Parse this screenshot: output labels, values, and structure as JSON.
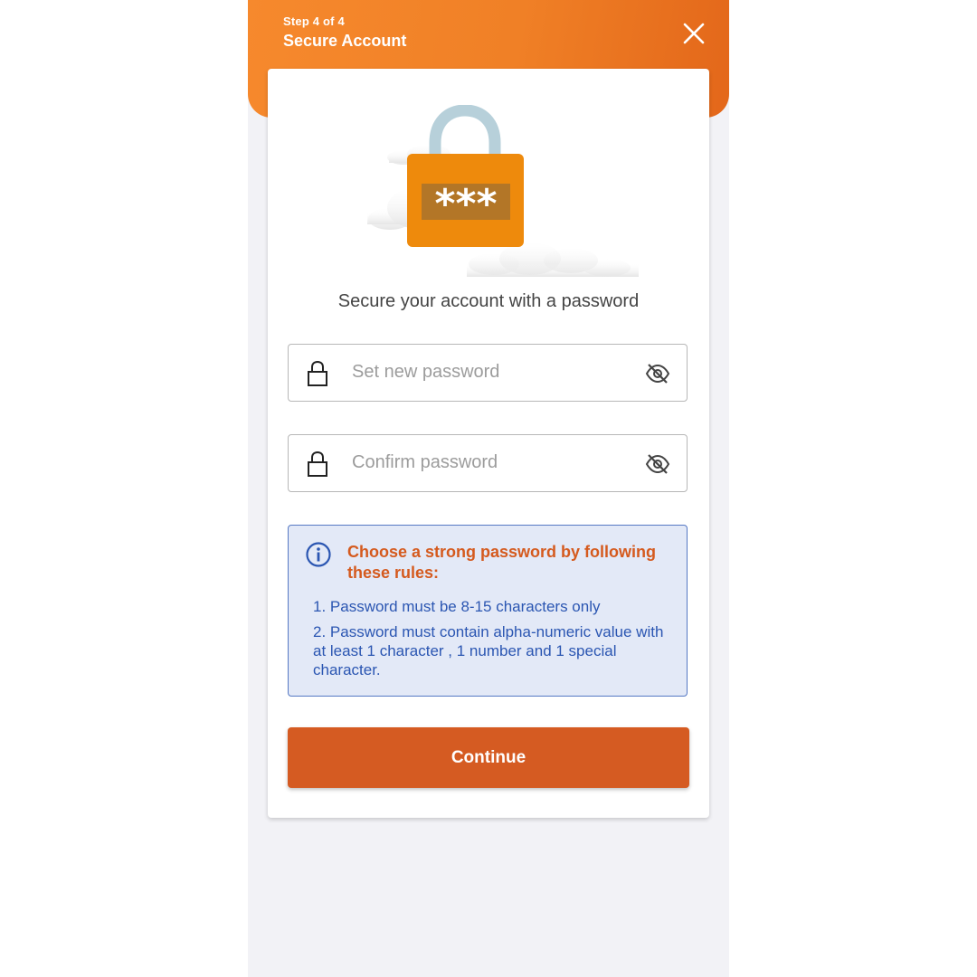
{
  "header": {
    "step_label": "Step 4 of 4",
    "title": "Secure Account",
    "close_icon": "close-icon"
  },
  "illustration": {
    "icon": "padlock-password-icon",
    "mask_text": "***"
  },
  "subtitle": "Secure your account with a password",
  "fields": {
    "new_password": {
      "placeholder": "Set new password",
      "value": "",
      "left_icon": "lock-icon",
      "right_icon": "eye-off-icon"
    },
    "confirm_password": {
      "placeholder": "Confirm password",
      "value": "",
      "left_icon": "lock-icon",
      "right_icon": "eye-off-icon"
    }
  },
  "rules": {
    "icon": "info-icon",
    "title": "Choose a strong password by following these rules:",
    "items": [
      "1. Password must be 8-15 characters only",
      "2.  Password must contain alpha-numeric value with at least 1 character , 1 number and 1 special character."
    ]
  },
  "continue_label": "Continue",
  "colors": {
    "header_orange": "#f08026",
    "button_orange": "#d55b22",
    "rules_title": "#d55a1e",
    "rules_text": "#2b56b2",
    "rules_bg": "#e3e9f7",
    "rules_border": "#5679c4",
    "lock_body": "#ee8a0c",
    "lock_shackle": "#b7d0da"
  }
}
